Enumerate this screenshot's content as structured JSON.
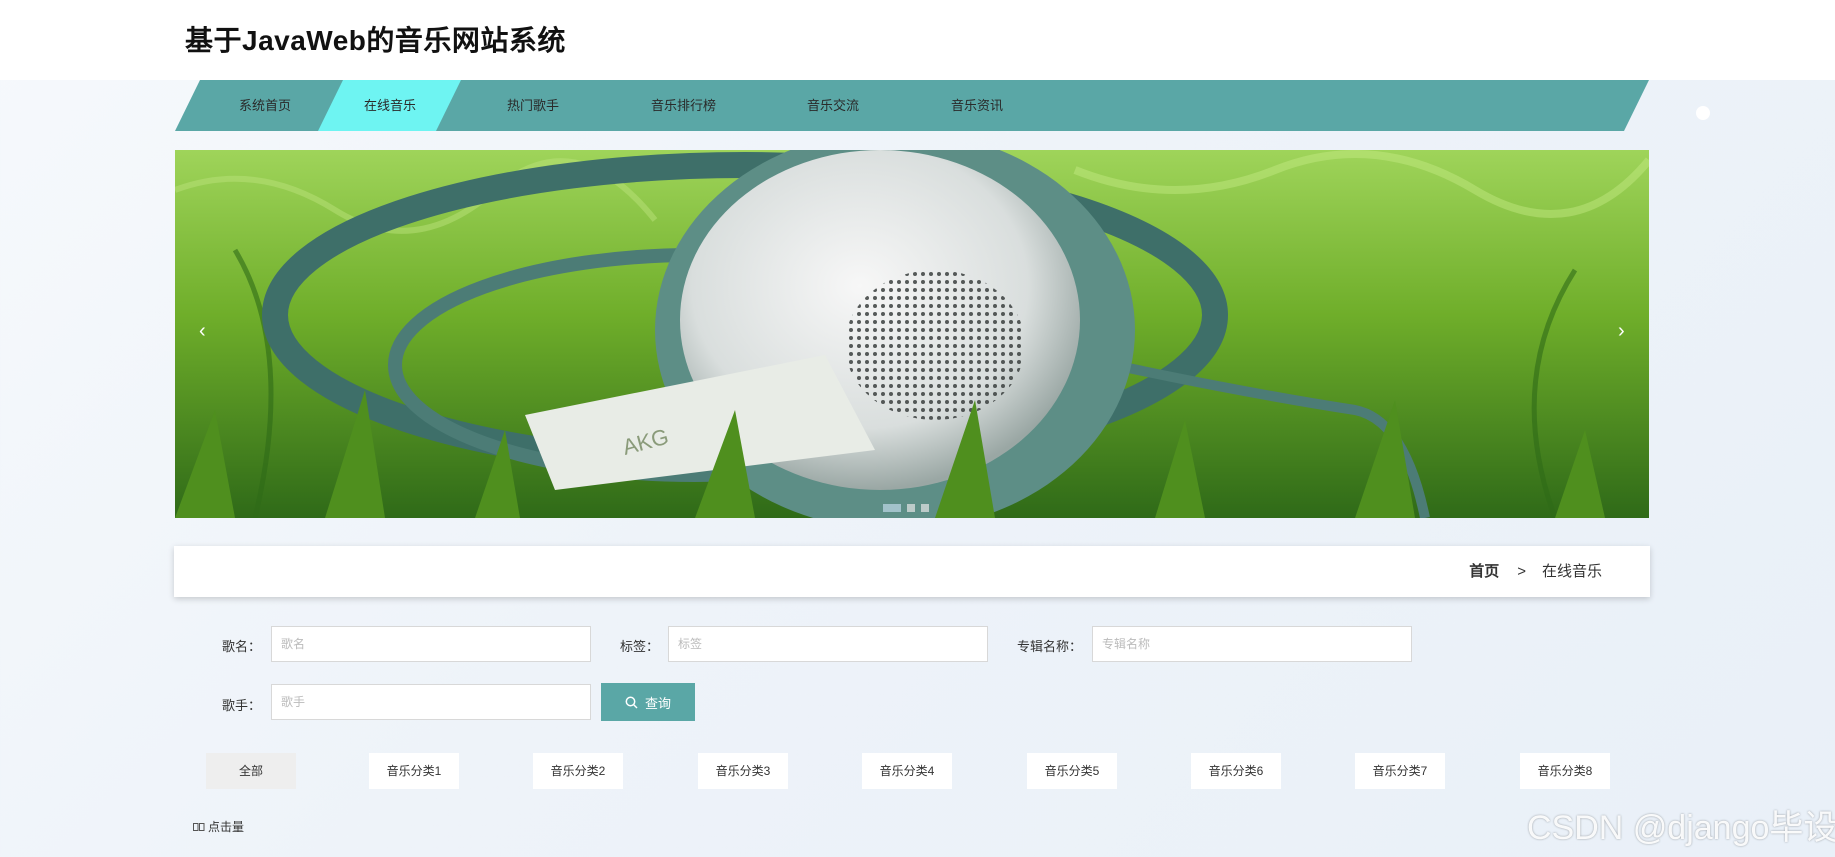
{
  "site": {
    "title": "基于JavaWeb的音乐网站系统"
  },
  "nav": {
    "items": [
      {
        "label": "系统首页"
      },
      {
        "label": "在线音乐",
        "active": true
      },
      {
        "label": "热门歌手"
      },
      {
        "label": "音乐排行榜"
      },
      {
        "label": "音乐交流"
      },
      {
        "label": "音乐资讯"
      }
    ],
    "color": "#5aa7a6",
    "active_color": "#6ef4f2"
  },
  "carousel": {
    "prev_icon": "‹",
    "next_icon": "›",
    "slide_count": 3,
    "active_slide": 1
  },
  "breadcrumb": {
    "home": "首页",
    "separator": ">",
    "current": "在线音乐"
  },
  "search": {
    "song_name": {
      "label": "歌名：",
      "placeholder": "歌名"
    },
    "tag": {
      "label": "标签：",
      "placeholder": "标签"
    },
    "album": {
      "label": "专辑名称：",
      "placeholder": "专辑名称"
    },
    "singer": {
      "label": "歌手：",
      "placeholder": "歌手"
    },
    "button_label": "查询",
    "button_color": "#5aa7a6"
  },
  "categories": [
    "全部",
    "音乐分类1",
    "音乐分类2",
    "音乐分类3",
    "音乐分类4",
    "音乐分类5",
    "音乐分类6",
    "音乐分类7",
    "音乐分类8"
  ],
  "sort": {
    "label": "点击量",
    "icon": "sort-icon"
  },
  "watermark": "CSDN @django毕设"
}
